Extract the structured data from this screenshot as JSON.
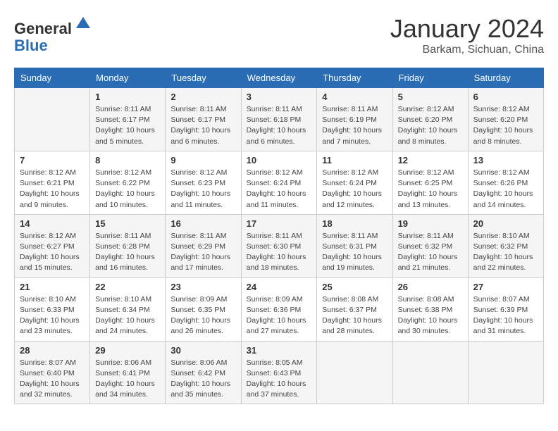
{
  "header": {
    "logo_general": "General",
    "logo_blue": "Blue",
    "month_title": "January 2024",
    "location": "Barkam, Sichuan, China"
  },
  "days_of_week": [
    "Sunday",
    "Monday",
    "Tuesday",
    "Wednesday",
    "Thursday",
    "Friday",
    "Saturday"
  ],
  "weeks": [
    [
      {
        "day": "",
        "info": ""
      },
      {
        "day": "1",
        "info": "Sunrise: 8:11 AM\nSunset: 6:17 PM\nDaylight: 10 hours\nand 5 minutes."
      },
      {
        "day": "2",
        "info": "Sunrise: 8:11 AM\nSunset: 6:17 PM\nDaylight: 10 hours\nand 6 minutes."
      },
      {
        "day": "3",
        "info": "Sunrise: 8:11 AM\nSunset: 6:18 PM\nDaylight: 10 hours\nand 6 minutes."
      },
      {
        "day": "4",
        "info": "Sunrise: 8:11 AM\nSunset: 6:19 PM\nDaylight: 10 hours\nand 7 minutes."
      },
      {
        "day": "5",
        "info": "Sunrise: 8:12 AM\nSunset: 6:20 PM\nDaylight: 10 hours\nand 8 minutes."
      },
      {
        "day": "6",
        "info": "Sunrise: 8:12 AM\nSunset: 6:20 PM\nDaylight: 10 hours\nand 8 minutes."
      }
    ],
    [
      {
        "day": "7",
        "info": "Sunrise: 8:12 AM\nSunset: 6:21 PM\nDaylight: 10 hours\nand 9 minutes."
      },
      {
        "day": "8",
        "info": "Sunrise: 8:12 AM\nSunset: 6:22 PM\nDaylight: 10 hours\nand 10 minutes."
      },
      {
        "day": "9",
        "info": "Sunrise: 8:12 AM\nSunset: 6:23 PM\nDaylight: 10 hours\nand 11 minutes."
      },
      {
        "day": "10",
        "info": "Sunrise: 8:12 AM\nSunset: 6:24 PM\nDaylight: 10 hours\nand 11 minutes."
      },
      {
        "day": "11",
        "info": "Sunrise: 8:12 AM\nSunset: 6:24 PM\nDaylight: 10 hours\nand 12 minutes."
      },
      {
        "day": "12",
        "info": "Sunrise: 8:12 AM\nSunset: 6:25 PM\nDaylight: 10 hours\nand 13 minutes."
      },
      {
        "day": "13",
        "info": "Sunrise: 8:12 AM\nSunset: 6:26 PM\nDaylight: 10 hours\nand 14 minutes."
      }
    ],
    [
      {
        "day": "14",
        "info": "Sunrise: 8:12 AM\nSunset: 6:27 PM\nDaylight: 10 hours\nand 15 minutes."
      },
      {
        "day": "15",
        "info": "Sunrise: 8:11 AM\nSunset: 6:28 PM\nDaylight: 10 hours\nand 16 minutes."
      },
      {
        "day": "16",
        "info": "Sunrise: 8:11 AM\nSunset: 6:29 PM\nDaylight: 10 hours\nand 17 minutes."
      },
      {
        "day": "17",
        "info": "Sunrise: 8:11 AM\nSunset: 6:30 PM\nDaylight: 10 hours\nand 18 minutes."
      },
      {
        "day": "18",
        "info": "Sunrise: 8:11 AM\nSunset: 6:31 PM\nDaylight: 10 hours\nand 19 minutes."
      },
      {
        "day": "19",
        "info": "Sunrise: 8:11 AM\nSunset: 6:32 PM\nDaylight: 10 hours\nand 21 minutes."
      },
      {
        "day": "20",
        "info": "Sunrise: 8:10 AM\nSunset: 6:32 PM\nDaylight: 10 hours\nand 22 minutes."
      }
    ],
    [
      {
        "day": "21",
        "info": "Sunrise: 8:10 AM\nSunset: 6:33 PM\nDaylight: 10 hours\nand 23 minutes."
      },
      {
        "day": "22",
        "info": "Sunrise: 8:10 AM\nSunset: 6:34 PM\nDaylight: 10 hours\nand 24 minutes."
      },
      {
        "day": "23",
        "info": "Sunrise: 8:09 AM\nSunset: 6:35 PM\nDaylight: 10 hours\nand 26 minutes."
      },
      {
        "day": "24",
        "info": "Sunrise: 8:09 AM\nSunset: 6:36 PM\nDaylight: 10 hours\nand 27 minutes."
      },
      {
        "day": "25",
        "info": "Sunrise: 8:08 AM\nSunset: 6:37 PM\nDaylight: 10 hours\nand 28 minutes."
      },
      {
        "day": "26",
        "info": "Sunrise: 8:08 AM\nSunset: 6:38 PM\nDaylight: 10 hours\nand 30 minutes."
      },
      {
        "day": "27",
        "info": "Sunrise: 8:07 AM\nSunset: 6:39 PM\nDaylight: 10 hours\nand 31 minutes."
      }
    ],
    [
      {
        "day": "28",
        "info": "Sunrise: 8:07 AM\nSunset: 6:40 PM\nDaylight: 10 hours\nand 32 minutes."
      },
      {
        "day": "29",
        "info": "Sunrise: 8:06 AM\nSunset: 6:41 PM\nDaylight: 10 hours\nand 34 minutes."
      },
      {
        "day": "30",
        "info": "Sunrise: 8:06 AM\nSunset: 6:42 PM\nDaylight: 10 hours\nand 35 minutes."
      },
      {
        "day": "31",
        "info": "Sunrise: 8:05 AM\nSunset: 6:43 PM\nDaylight: 10 hours\nand 37 minutes."
      },
      {
        "day": "",
        "info": ""
      },
      {
        "day": "",
        "info": ""
      },
      {
        "day": "",
        "info": ""
      }
    ]
  ]
}
